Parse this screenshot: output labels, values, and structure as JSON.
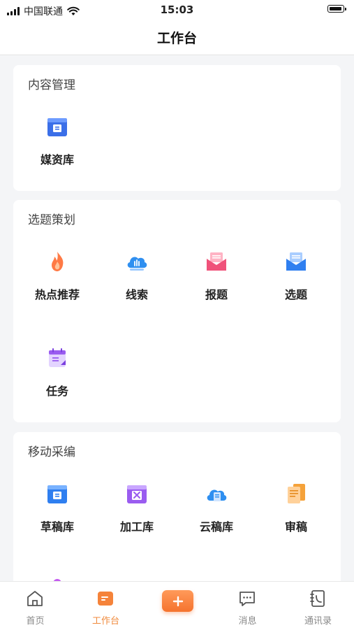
{
  "status_bar": {
    "carrier": "中国联通",
    "time": "15:03"
  },
  "header": {
    "title": "工作台"
  },
  "sections": [
    {
      "title": "内容管理",
      "items": [
        {
          "label": "媒资库",
          "icon": "media-library-icon"
        }
      ]
    },
    {
      "title": "选题策划",
      "items": [
        {
          "label": "热点推荐",
          "icon": "flame-icon"
        },
        {
          "label": "线索",
          "icon": "cloud-clue-icon"
        },
        {
          "label": "报题",
          "icon": "envelope-report-icon"
        },
        {
          "label": "选题",
          "icon": "envelope-topic-icon"
        },
        {
          "label": "任务",
          "icon": "calendar-task-icon"
        }
      ]
    },
    {
      "title": "移动采编",
      "items": [
        {
          "label": "草稿库",
          "icon": "draft-box-icon"
        },
        {
          "label": "加工库",
          "icon": "tools-box-icon"
        },
        {
          "label": "云稿库",
          "icon": "cloud-doc-icon"
        },
        {
          "label": "审稿",
          "icon": "review-doc-icon"
        }
      ]
    }
  ],
  "tabbar": {
    "items": [
      {
        "label": "首页",
        "icon": "home-icon"
      },
      {
        "label": "工作台",
        "icon": "workbench-icon",
        "active": true
      },
      {
        "label": "",
        "icon": "plus-icon"
      },
      {
        "label": "消息",
        "icon": "message-icon"
      },
      {
        "label": "通讯录",
        "icon": "contacts-icon"
      }
    ]
  },
  "colors": {
    "accent": "#f08a3c",
    "blue": "#2f6fe8",
    "purple": "#9a5cf0",
    "pink": "#f0527a"
  }
}
